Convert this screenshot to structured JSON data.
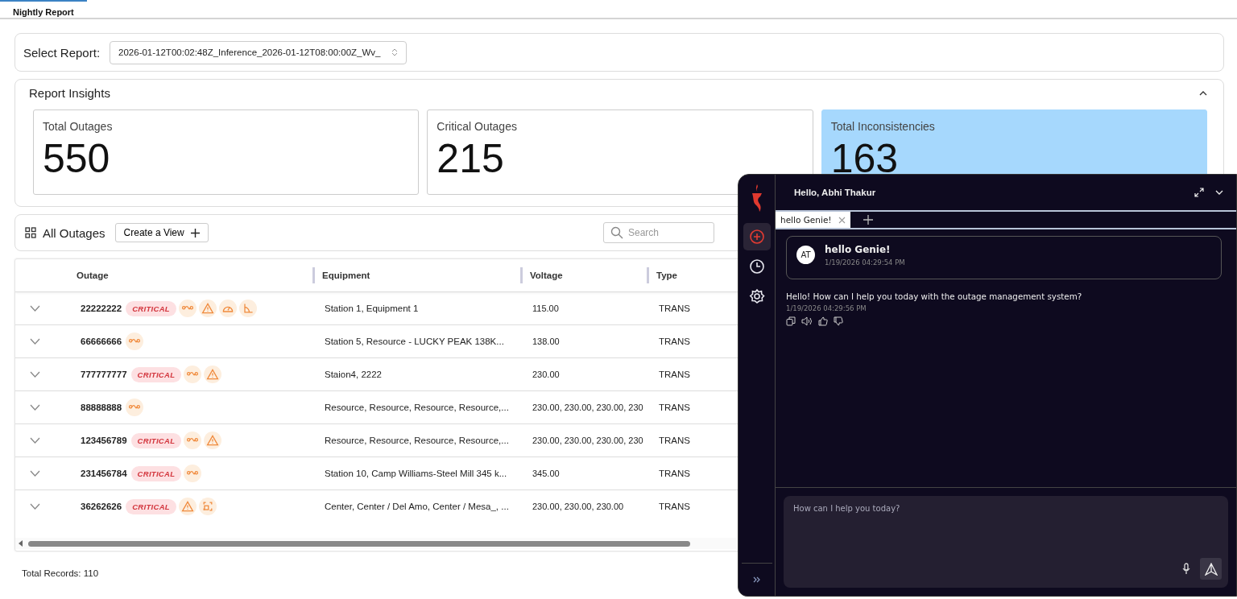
{
  "tabs": [
    {
      "label": "Nightly Report",
      "selected": true
    }
  ],
  "report_select": {
    "label": "Select Report:",
    "value": "2026-01-12T00:02:48Z_Inference_2026-01-12T08:00:00Z_Wv_"
  },
  "insights": {
    "title": "Report Insights",
    "expanded": true,
    "cards": [
      {
        "label": "Total Outages",
        "value": "550",
        "highlighted": false
      },
      {
        "label": "Critical Outages",
        "value": "215",
        "highlighted": false
      },
      {
        "label": "Total Inconsistencies",
        "value": "163",
        "highlighted": true
      }
    ]
  },
  "outages": {
    "title": "All Outages",
    "create_button": "Create a View",
    "search": {
      "placeholder": "Search"
    }
  },
  "table": {
    "columns": [
      "Outage",
      "Equipment",
      "Voltage",
      "Type"
    ],
    "rows": [
      {
        "outage": "22222222",
        "badge": "CRITICAL",
        "icons": [
          {
            "kind": "line"
          },
          {
            "kind": "warning"
          },
          {
            "kind": "gauge"
          },
          {
            "kind": "angle"
          }
        ],
        "equipment": "Station 1, Equipment 1",
        "voltage": "115.00",
        "type": "TRANS"
      },
      {
        "outage": "66666666",
        "icons": [
          {
            "kind": "line"
          }
        ],
        "equipment": "Station 5, Resource - LUCKY PEAK 138K...",
        "voltage": "138.00",
        "type": "TRANS"
      },
      {
        "outage": "777777777",
        "badge": "CRITICAL",
        "icons": [
          {
            "kind": "line"
          },
          {
            "kind": "warning"
          }
        ],
        "equipment": "Staion4, 2222",
        "voltage": "230.00",
        "type": "TRANS"
      },
      {
        "outage": "88888888",
        "icons": [
          {
            "kind": "line"
          }
        ],
        "equipment": "Resource, Resource, Resource, Resource,...",
        "voltage": "230.00, 230.00, 230.00, 230",
        "type": "TRANS"
      },
      {
        "outage": "123456789",
        "badge": "CRITICAL",
        "icons": [
          {
            "kind": "line"
          },
          {
            "kind": "warning"
          }
        ],
        "equipment": "Resource, Resource, Resource, Resource,...",
        "voltage": "230.00, 230.00, 230.00, 230",
        "type": "TRANS"
      },
      {
        "outage": "231456784",
        "badge": "CRITICAL",
        "icons": [
          {
            "kind": "line"
          }
        ],
        "equipment": "Station 10, Camp Williams-Steel Mill 345 k...",
        "voltage": "345.00",
        "type": "TRANS"
      },
      {
        "outage": "36262626",
        "badge": "CRITICAL",
        "icons": [
          {
            "kind": "warning"
          },
          {
            "kind": "frame"
          }
        ],
        "equipment": "Center, Center / Del Amo, Center / Mesa_, ...",
        "voltage": "230.00, 230.00, 230.00",
        "type": "TRANS"
      }
    ]
  },
  "footer": {
    "total": "Total Records: 110"
  },
  "chat": {
    "greeting": "Hello, Abhi Thakur",
    "nav": [
      {
        "kind": "new",
        "selected": true
      },
      {
        "kind": "history",
        "selected": false
      },
      {
        "kind": "settings",
        "selected": false
      }
    ],
    "tabs": [
      {
        "label": "hello Genie!",
        "selected": true
      }
    ],
    "messages": [
      {
        "kind": "user",
        "avatar": "AT",
        "text": "hello Genie!",
        "time": "1/19/2026 04:29:54 PM"
      },
      {
        "kind": "bot",
        "text": "Hello! How can I help you today with the outage management system?",
        "time": "1/19/2026 04:29:56 PM"
      }
    ],
    "input": {
      "placeholder": "How can I help you today?"
    }
  }
}
